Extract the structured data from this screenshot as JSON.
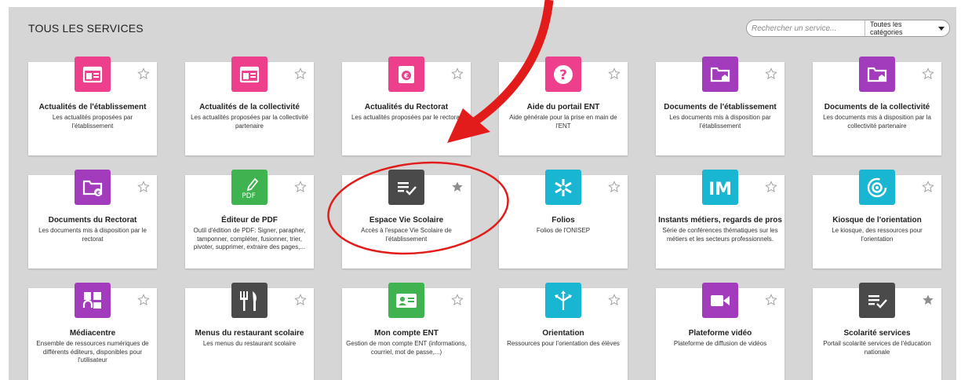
{
  "header": {
    "title": "TOUS LES SERVICES",
    "search_placeholder": "Rechercher un service...",
    "category_label": "Toutes les catégories"
  },
  "colors": {
    "pink": "#ee3f8c",
    "purple": "#a33bbd",
    "green": "#3fb34f",
    "gray_dark": "#4a4a4a",
    "cyan": "#19b6d2",
    "annotation_red": "#e21b1b"
  },
  "services": [
    {
      "name": "Actualités de l'établissement",
      "desc": "Les actualités proposées par l'établissement",
      "icon": "news-icon",
      "color": "#ee3f8c",
      "favorite": false
    },
    {
      "name": "Actualités de la collectivité",
      "desc": "Les actualités proposées par la collectivité partenaire",
      "icon": "news-icon",
      "color": "#ee3f8c",
      "favorite": false
    },
    {
      "name": "Actualités du Rectorat",
      "desc": "Les actualités proposées par le rectorat",
      "icon": "news-euro-icon",
      "color": "#ee3f8c",
      "favorite": false
    },
    {
      "name": "Aide du portail ENT",
      "desc": "Aide générale pour la prise en main de l'ENT",
      "icon": "help-icon",
      "color": "#ee3f8c",
      "favorite": false
    },
    {
      "name": "Documents de l'établissement",
      "desc": "Les documents mis à disposition par l'établissement",
      "icon": "folder-house-icon",
      "color": "#a33bbd",
      "favorite": false
    },
    {
      "name": "Documents de la collectivité",
      "desc": "Les documents mis à disposition par la collectivité partenaire",
      "icon": "folder-house-icon",
      "color": "#a33bbd",
      "favorite": false
    },
    {
      "name": "Documents du Rectorat",
      "desc": "Les documents mis à disposition par le rectorat",
      "icon": "folder-euro-icon",
      "color": "#a33bbd",
      "favorite": false
    },
    {
      "name": "Éditeur de PDF",
      "desc": "Outil d'édition de PDF: Signer, parapher, tamponner, compléter, fusionner, trier, pivoter, supprimer, extraire des pages,...",
      "icon": "pdf-pen-icon",
      "color": "#3fb34f",
      "favorite": false
    },
    {
      "name": "Espace Vie Scolaire",
      "desc": "Accès à l'espace Vie Scolaire de l'établissement",
      "icon": "checklist-icon",
      "color": "#4a4a4a",
      "favorite": true
    },
    {
      "name": "Folios",
      "desc": "Folios de l'ONISEP",
      "icon": "asterisk-icon",
      "color": "#19b6d2",
      "favorite": false
    },
    {
      "name": "Instants métiers, regards de pros",
      "desc": "Série de conférences thématiques sur les métiers et les secteurs professionnels.",
      "icon": "im-logo-icon",
      "color": "#19b6d2",
      "favorite": false
    },
    {
      "name": "Kiosque de l'orientation",
      "desc": "Le kiosque, des ressources pour l'orientation",
      "icon": "target-icon",
      "color": "#19b6d2",
      "favorite": false
    },
    {
      "name": "Médiacentre",
      "desc": "Ensemble de ressources numériques de différents éditeurs, disponibles pour l'utilisateur",
      "icon": "media-icon",
      "color": "#a33bbd",
      "favorite": false
    },
    {
      "name": "Menus du restaurant scolaire",
      "desc": "Les menus du restaurant scolaire",
      "icon": "cutlery-icon",
      "color": "#4a4a4a",
      "favorite": false
    },
    {
      "name": "Mon compte ENT",
      "desc": "Gestion de mon compte ENT (informations, courriel, mot de passe,...)",
      "icon": "id-card-icon",
      "color": "#3fb34f",
      "favorite": false
    },
    {
      "name": "Orientation",
      "desc": "Ressources pour l'orientation des élèves",
      "icon": "arrows-icon",
      "color": "#19b6d2",
      "favorite": false
    },
    {
      "name": "Plateforme vidéo",
      "desc": "Plateforme de diffusion de vidéos",
      "icon": "video-camera-icon",
      "color": "#a33bbd",
      "favorite": false
    },
    {
      "name": "Scolarité services",
      "desc": "Portail scolarité services de l'éducation nationale",
      "icon": "checklist-icon",
      "color": "#4a4a4a",
      "favorite": true
    }
  ]
}
